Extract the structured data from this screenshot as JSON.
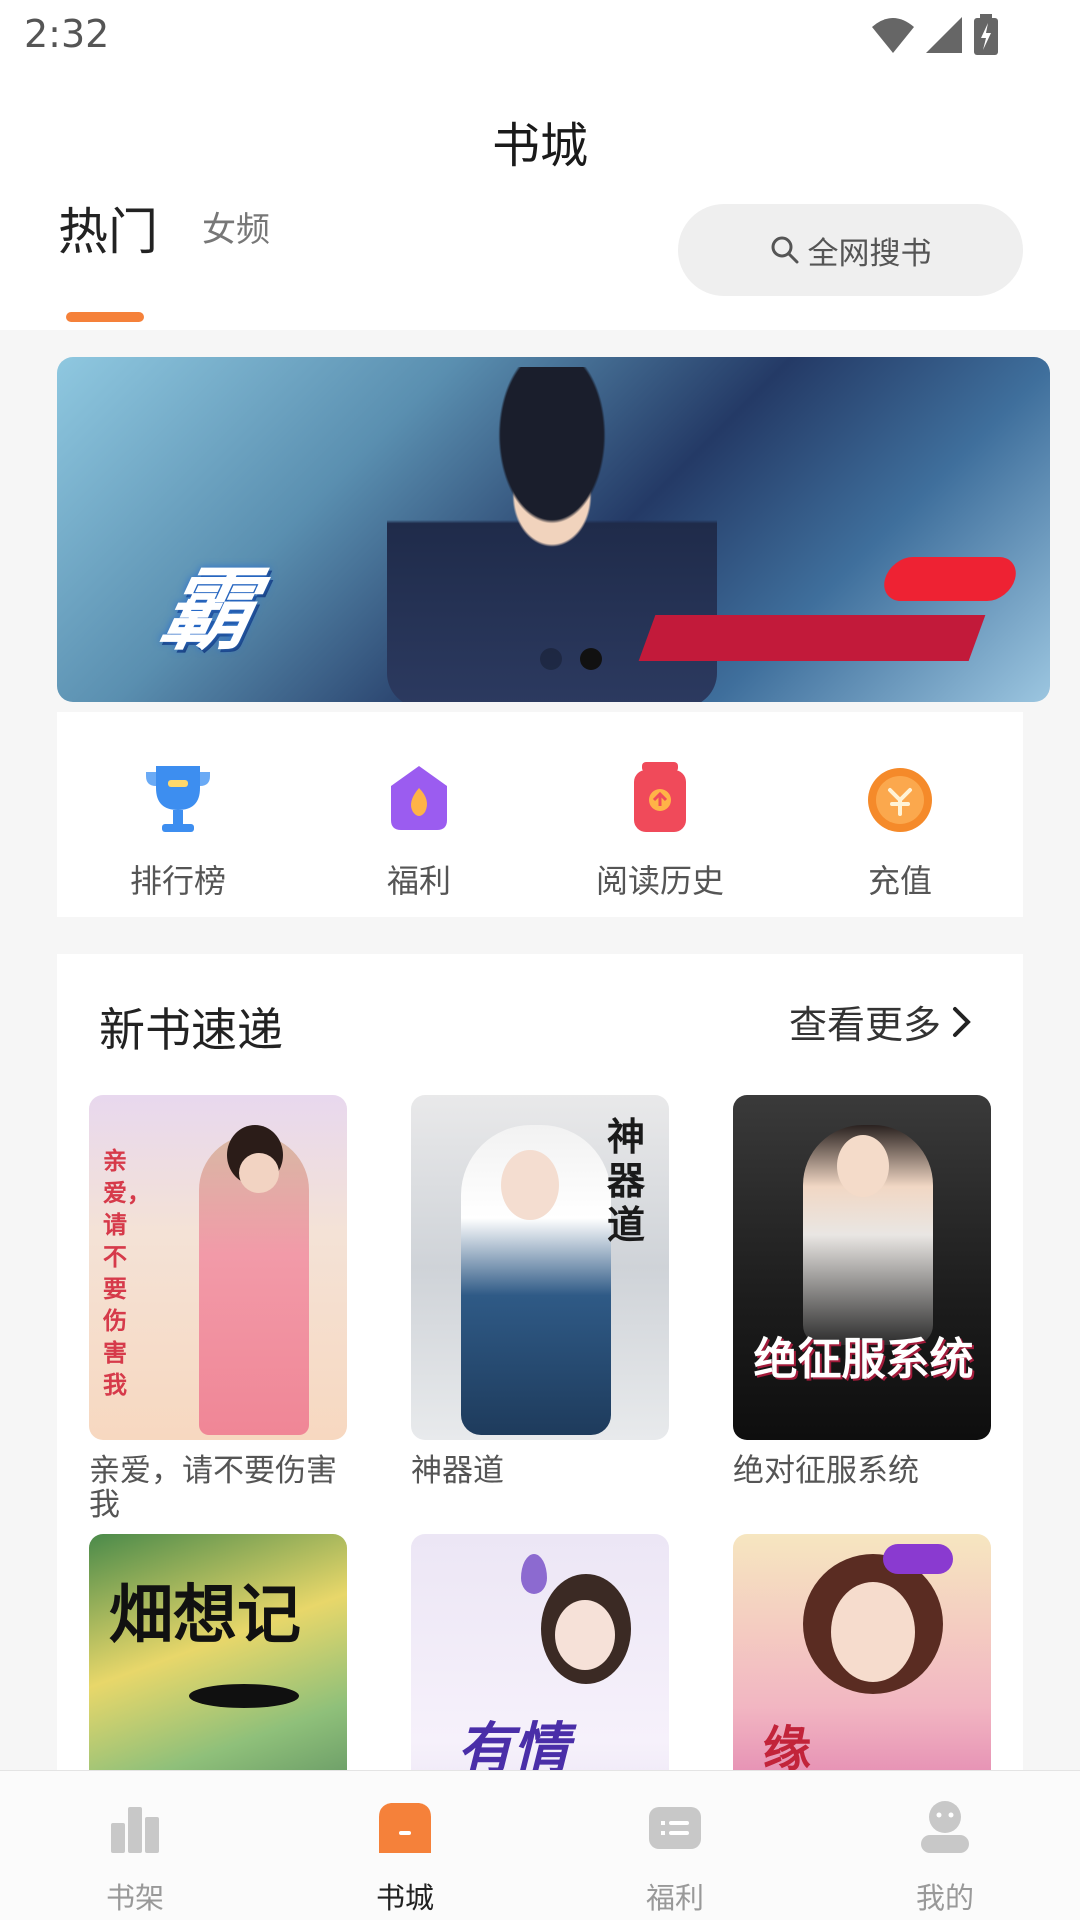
{
  "status_bar": {
    "time": "2:32"
  },
  "header": {
    "title": "书城",
    "tabs": [
      {
        "label": "热门",
        "active": true
      },
      {
        "label": "女频",
        "active": false
      }
    ],
    "search_placeholder": "全网搜书"
  },
  "banner": {
    "title_text": "霸",
    "author_text": "",
    "page_count": 2,
    "active_index": 1
  },
  "quick_menu": [
    {
      "label": "排行榜",
      "icon": "trophy-icon",
      "color": "#3d8ef0"
    },
    {
      "label": "福利",
      "icon": "fire-gift-icon",
      "color": "#9b5cf0"
    },
    {
      "label": "阅读历史",
      "icon": "history-icon",
      "color": "#f04a5a"
    },
    {
      "label": "充值",
      "icon": "coin-icon",
      "color": "#f58a2a"
    }
  ],
  "new_books": {
    "title": "新书速递",
    "more_label": "查看更多",
    "books": [
      {
        "title": "亲爱，请不要伤害我",
        "cover_text": "亲爱，请不要伤害我"
      },
      {
        "title": "神器道",
        "cover_text": "神器道"
      },
      {
        "title": "绝对征服系统",
        "cover_text": "绝征服系统"
      },
      {
        "title": "",
        "cover_text": "畑想记"
      },
      {
        "title": "",
        "cover_text": "有情"
      },
      {
        "title": "",
        "cover_text": "缘"
      }
    ]
  },
  "bottom_nav": [
    {
      "label": "书架",
      "icon": "bookshelf-icon",
      "active": false
    },
    {
      "label": "书城",
      "icon": "bookstore-icon",
      "active": true
    },
    {
      "label": "福利",
      "icon": "welfare-icon",
      "active": false
    },
    {
      "label": "我的",
      "icon": "profile-icon",
      "active": false
    }
  ],
  "colors": {
    "accent": "#f5813a",
    "background": "#f6f6f6",
    "search_bg": "#efefef"
  }
}
